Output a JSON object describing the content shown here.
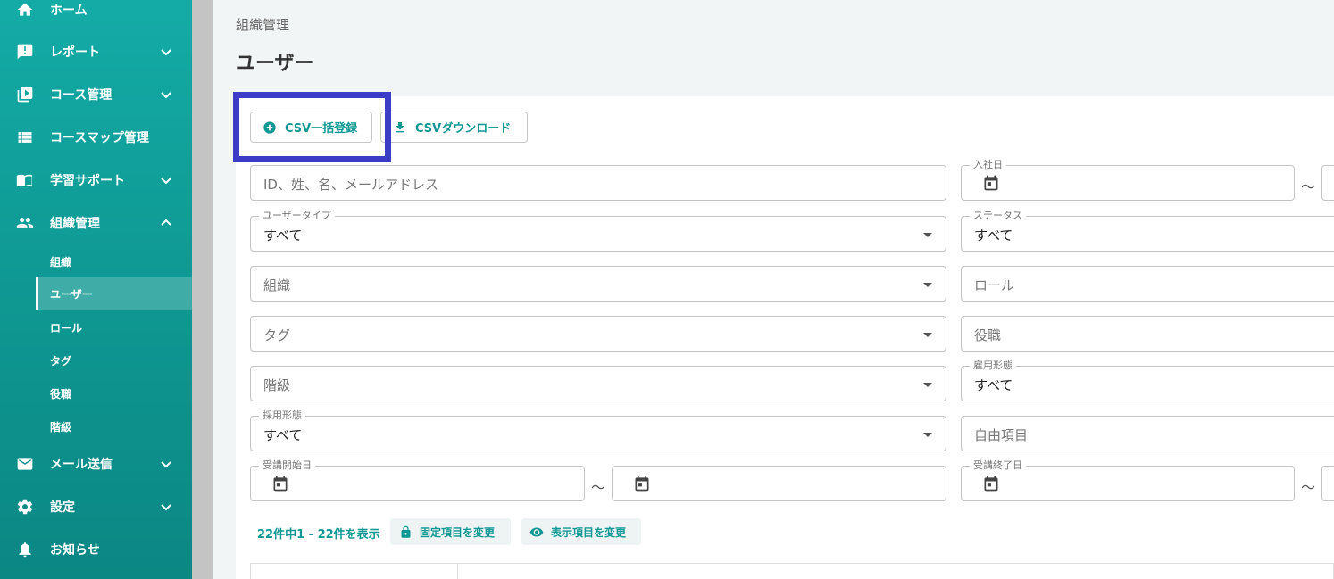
{
  "sidebar": {
    "items": [
      {
        "label": "ホーム",
        "icon": "home-icon"
      },
      {
        "label": "レポート",
        "icon": "report-icon"
      },
      {
        "label": "コース管理",
        "icon": "course-icon"
      },
      {
        "label": "コースマップ管理",
        "icon": "list-icon"
      },
      {
        "label": "学習サポート",
        "icon": "book-icon"
      },
      {
        "label": "組織管理",
        "icon": "people-icon"
      },
      {
        "label": "メール送信",
        "icon": "mail-icon"
      },
      {
        "label": "設定",
        "icon": "gear-icon"
      },
      {
        "label": "お知らせ",
        "icon": "bell-icon"
      }
    ],
    "sub_items": [
      "組織",
      "ユーザー",
      "ロール",
      "タグ",
      "役職",
      "階級"
    ],
    "active_sub": "ユーザー"
  },
  "header": {
    "breadcrumb": "組織管理",
    "title": "ユーザー"
  },
  "toolbar": {
    "csv_import_label": "CSV一括登録",
    "csv_download_label": "CSVダウンロード"
  },
  "filters": {
    "search_placeholder": "ID、姓、名、メールアドレス",
    "join_date_label": "入社日",
    "user_type_label": "ユーザータイプ",
    "user_type_value": "すべて",
    "status_label": "ステータス",
    "status_value": "すべて",
    "org_placeholder": "組織",
    "role_placeholder": "ロール",
    "tag_placeholder": "タグ",
    "position_placeholder": "役職",
    "rank_placeholder": "階級",
    "employment_type_label": "雇用形態",
    "employment_type_value": "すべて",
    "hiring_type_label": "採用形態",
    "hiring_type_value": "すべて",
    "custom_field_placeholder": "自由項目",
    "course_start_label": "受講開始日",
    "course_end_label": "受講終了日",
    "range_separator": "～"
  },
  "results": {
    "count_text": "22件中1 - 22件を表示",
    "fixed_columns_label": "固定項目を変更",
    "display_columns_label": "表示項目を変更"
  },
  "colors": {
    "accent": "#0f9893",
    "highlight": "#3d3cc6"
  }
}
